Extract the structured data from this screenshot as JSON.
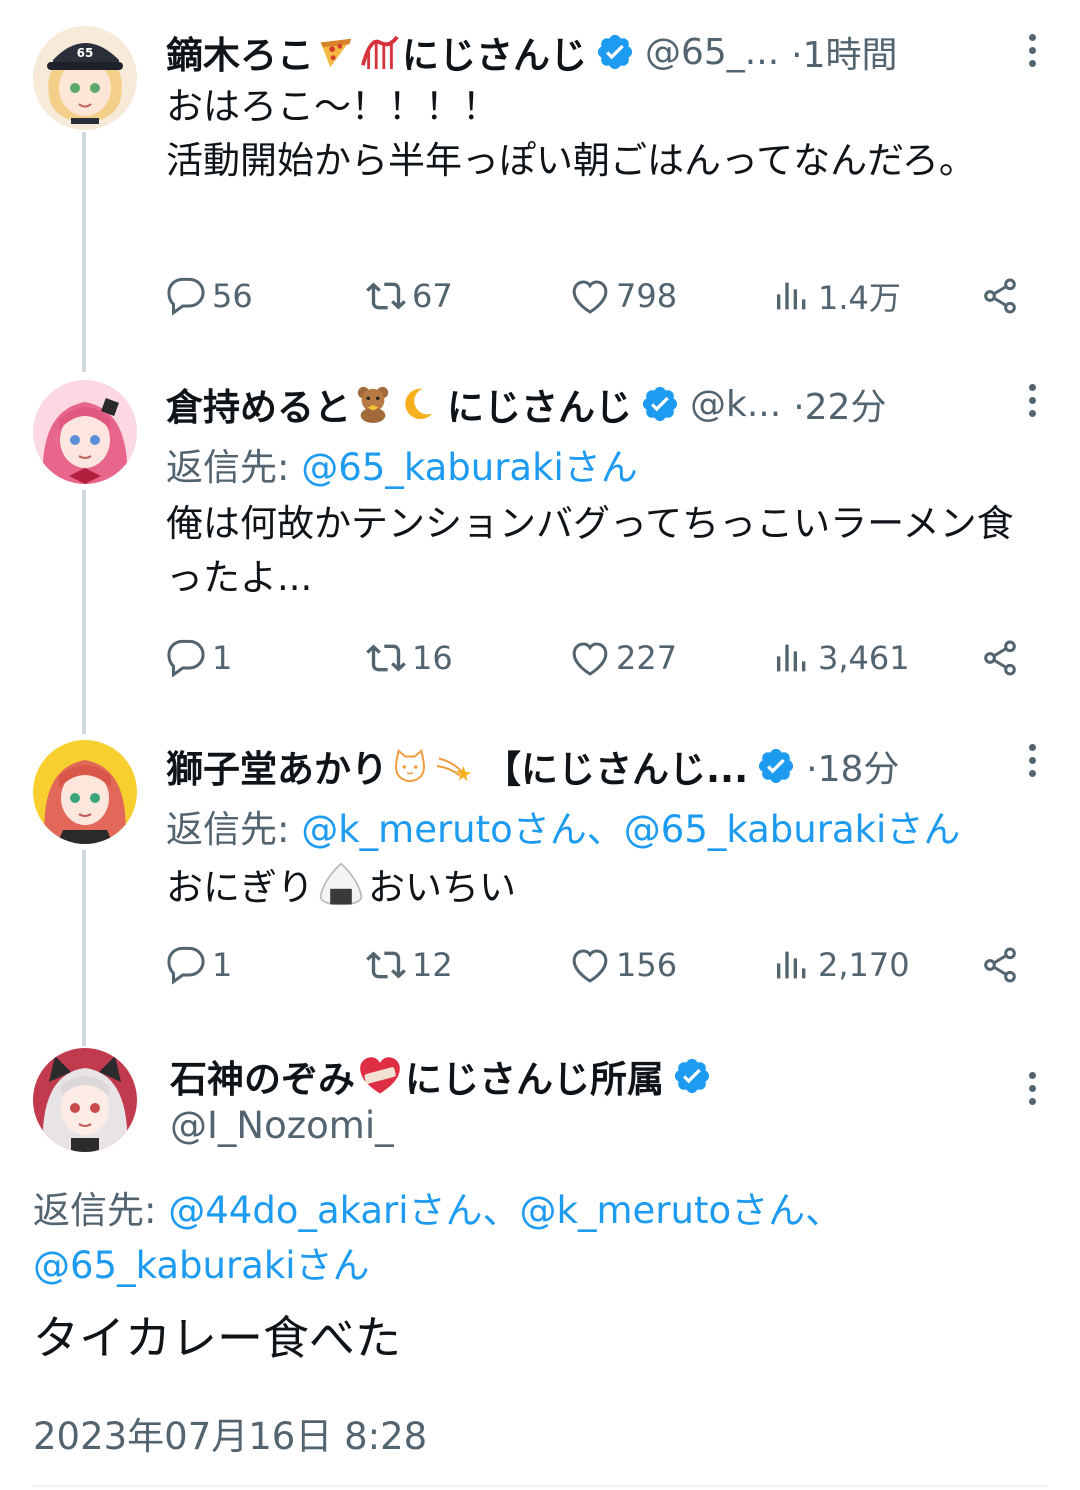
{
  "tweets": [
    {
      "name": "鏑木ろこ",
      "emoji1": "pizza-emoji",
      "emoji2": "roller-coaster-emoji",
      "affiliation": "にじさんじ",
      "handle": "@65_...",
      "time": "·1時間",
      "body": "おはろこ〜！！！！\n活動開始から半年っぽい朝ごはんってなんだろ。",
      "stats": {
        "replies": "56",
        "retweets": "67",
        "likes": "798",
        "views": "1.4万"
      }
    },
    {
      "name": "倉持めると",
      "emoji1": "teddy-bear-emoji",
      "emoji2": "crescent-moon-emoji",
      "affiliation": "にじさんじ",
      "handle": "@k...",
      "time": "·22分",
      "reply_label": "返信先:",
      "reply_to": "@65_kaburakiさん",
      "body": "俺は何故かテンションバグってちっこいラーメン食ったよ...",
      "stats": {
        "replies": "1",
        "retweets": "16",
        "likes": "227",
        "views": "3,461"
      }
    },
    {
      "name": "獅子堂あかり",
      "emoji1": "cat-face-emoji",
      "emoji2": "shooting-star-emoji",
      "affiliation": "【にじさんじ...",
      "time": "·18分",
      "reply_label": "返信先:",
      "reply_to": "@k_merutoさん、@65_kaburakiさん",
      "body_before": "おにぎり",
      "body_emoji": "rice-ball-emoji",
      "body_after": "おいちい",
      "stats": {
        "replies": "1",
        "retweets": "12",
        "likes": "156",
        "views": "2,170"
      }
    }
  ],
  "main_tweet": {
    "name": "石神のぞみ",
    "emoji": "mending-heart-emoji",
    "affiliation": "にじさんじ所属",
    "handle": "@I_Nozomi_",
    "reply_label": "返信先:",
    "reply_line1": "@44do_akariさん、@k_merutoさん、",
    "reply_line2": "@65_kaburakiさん",
    "body": "タイカレー食べた",
    "timestamp": "2023年07月16日 8:28"
  },
  "colors": {
    "link": "#1d9bf0",
    "verified": "#1d9bf0",
    "secondary_text": "#536471",
    "thread_line": "#cfd9de"
  }
}
